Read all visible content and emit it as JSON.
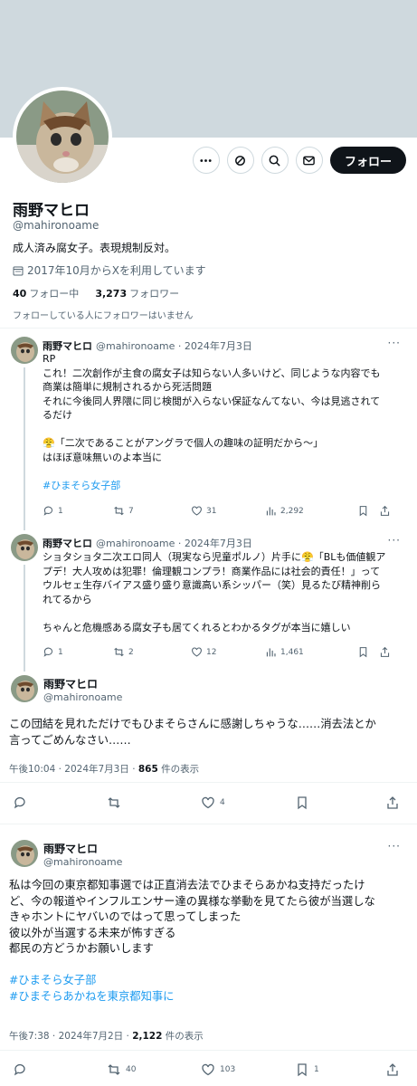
{
  "profile": {
    "name": "雨野マヒロ",
    "handle": "@mahironoame",
    "bio": "成人済み腐女子。表現規制反対。",
    "joined": "2017年10月からXを利用しています",
    "following_count": "40",
    "following_label": "フォロー中",
    "followers_count": "3,273",
    "followers_label": "フォロワー",
    "followers_note": "フォローしている人にフォロワーはいません",
    "follow_button": "フォロー"
  },
  "tweets": [
    {
      "name": "雨野マヒロ",
      "meta": "@mahironoame · 2024年7月3日",
      "lines": [
        "RP",
        "これ！二次創作が主食の腐女子は知らない人多いけど、同じような内容でも",
        "商業は簡単に規制されるから死活問題",
        "それに今後同人界隈に同じ検閲が入らない保証なんてない、今は見逃されて",
        "るだけ",
        "",
        "😤「二次であることがアングラで個人の趣味の証明だから～」",
        "はほぼ意味無いのよ本当に",
        "",
        "#ひまそら女子部"
      ],
      "replies": "1",
      "retweets": "7",
      "likes": "31",
      "views": "2,292"
    },
    {
      "name": "雨野マヒロ",
      "meta": "@mahironoame · 2024年7月3日",
      "lines": [
        "ショタショタ二次エロ同人（現実なら児童ポルノ）片手に😤「BLも価値観ア",
        "プデ！大人攻めは犯罪！倫理観コンプラ！商業作品には社会的責任！」って",
        "ウルセェ生存バイアス盛り盛り意識高い系シッパー（笑）見るたび精神削ら",
        "れてるから",
        "",
        "ちゃんと危機感ある腐女子も居てくれるとわかるタグが本当に嬉しい"
      ],
      "replies": "1",
      "retweets": "2",
      "likes": "12",
      "views": "1,461"
    }
  ],
  "main_tweet": {
    "name": "雨野マヒロ",
    "handle": "@mahironoame",
    "lines": [
      "この団結を見れただけでもひまそらさんに感謝しちゃうな……消去法とか",
      "言ってごめんなさい……"
    ],
    "time": "午後10:04 · 2024年7月3日 · ",
    "views_count": "865",
    "views_label": " 件の表示",
    "likes": "4"
  },
  "last_tweet": {
    "name": "雨野マヒロ",
    "handle": "@mahironoame",
    "lines": [
      "私は今回の東京都知事選では正直消去法でひまそらあかね支持だったけ",
      "ど、今の報道やインフルエンサー達の異様な挙動を見てたら彼が当選しな",
      "きゃホントにヤバいのではって思ってしまった",
      "彼以外が当選する未来が怖すぎる",
      "都民の方どうかお願いします",
      "",
      "#ひまそら女子部",
      "#ひまそらあかねを東京都知事に"
    ],
    "time": "午後7:38 · 2024年7月2日 · ",
    "views_count": "2,122",
    "views_label": " 件の表示",
    "retweets": "40",
    "likes": "103",
    "bookmarks": "1"
  },
  "colors": {
    "accent": "#1d9bf0",
    "text": "#0f1419",
    "muted": "#536471",
    "banner": "#cfd9de"
  }
}
